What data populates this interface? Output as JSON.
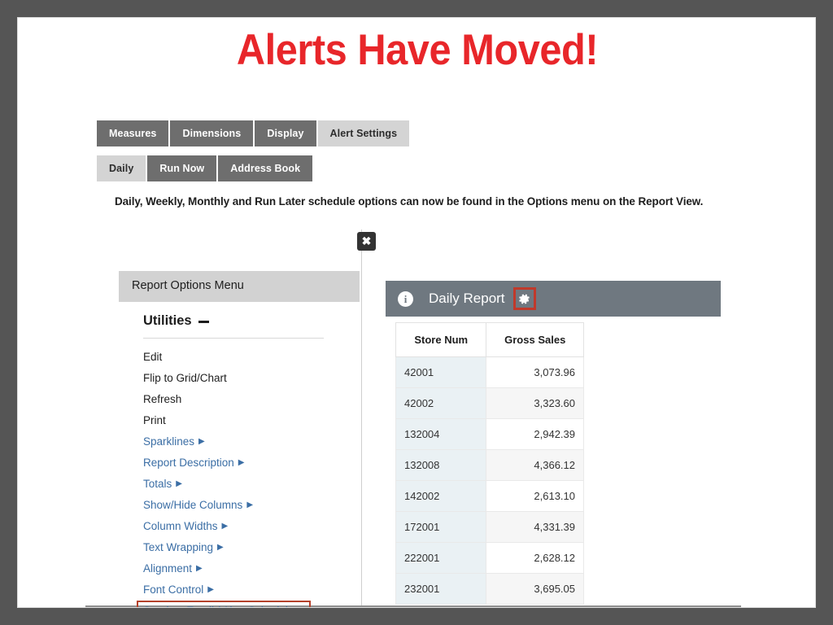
{
  "slide": {
    "title": "Alerts Have Moved!",
    "title_color": "#e8262a",
    "frame_color": "#555555"
  },
  "tabs_primary": [
    {
      "label": "Measures",
      "active": false
    },
    {
      "label": "Dimensions",
      "active": false
    },
    {
      "label": "Display",
      "active": false
    },
    {
      "label": "Alert Settings",
      "active": true
    }
  ],
  "tabs_secondary": [
    {
      "label": "Daily",
      "active": true
    },
    {
      "label": "Run Now",
      "active": false
    },
    {
      "label": "Address Book",
      "active": false
    }
  ],
  "instruction": "Daily, Weekly, Monthly and Run Later schedule options can now be found in the Options menu on the Report View.",
  "options_panel": {
    "close_label": "✖",
    "header_label": "Report Options Menu",
    "section_heading": "Utilities",
    "collapse_icon": "minus-icon",
    "items": [
      {
        "label": "Edit",
        "link": false,
        "submenu": false,
        "highlight": false
      },
      {
        "label": "Flip to Grid/Chart",
        "link": false,
        "submenu": false,
        "highlight": false
      },
      {
        "label": "Refresh",
        "link": false,
        "submenu": false,
        "highlight": false
      },
      {
        "label": "Print",
        "link": false,
        "submenu": false,
        "highlight": false
      },
      {
        "label": "Sparklines",
        "link": true,
        "submenu": true,
        "highlight": false
      },
      {
        "label": "Report Description",
        "link": true,
        "submenu": true,
        "highlight": false
      },
      {
        "label": "Totals",
        "link": true,
        "submenu": true,
        "highlight": false
      },
      {
        "label": "Show/Hide Columns",
        "link": true,
        "submenu": true,
        "highlight": false
      },
      {
        "label": "Column Widths",
        "link": true,
        "submenu": true,
        "highlight": false
      },
      {
        "label": "Text Wrapping",
        "link": true,
        "submenu": true,
        "highlight": false
      },
      {
        "label": "Alignment",
        "link": true,
        "submenu": true,
        "highlight": false
      },
      {
        "label": "Font Control",
        "link": true,
        "submenu": true,
        "highlight": false
      },
      {
        "label": "Send as Email / Alert Schedule",
        "link": true,
        "submenu": true,
        "highlight": true
      }
    ],
    "submenu_caret": "▶",
    "link_color": "#3b6ea5",
    "highlight_color": "#b5422c"
  },
  "report": {
    "info_icon": "info-icon",
    "info_glyph": "i",
    "title": "Daily Report",
    "gear_icon": "gear-icon",
    "gear_highlight_color": "#c0392b",
    "header_color": "#6f7880",
    "columns": [
      "Store Num",
      "Gross Sales"
    ],
    "rows": [
      {
        "store": "42001",
        "sales": "3,073.96"
      },
      {
        "store": "42002",
        "sales": "3,323.60"
      },
      {
        "store": "132004",
        "sales": "2,942.39"
      },
      {
        "store": "132008",
        "sales": "4,366.12"
      },
      {
        "store": "142002",
        "sales": "2,613.10"
      },
      {
        "store": "172001",
        "sales": "4,331.39"
      },
      {
        "store": "222001",
        "sales": "2,628.12"
      },
      {
        "store": "232001",
        "sales": "3,695.05"
      }
    ]
  }
}
